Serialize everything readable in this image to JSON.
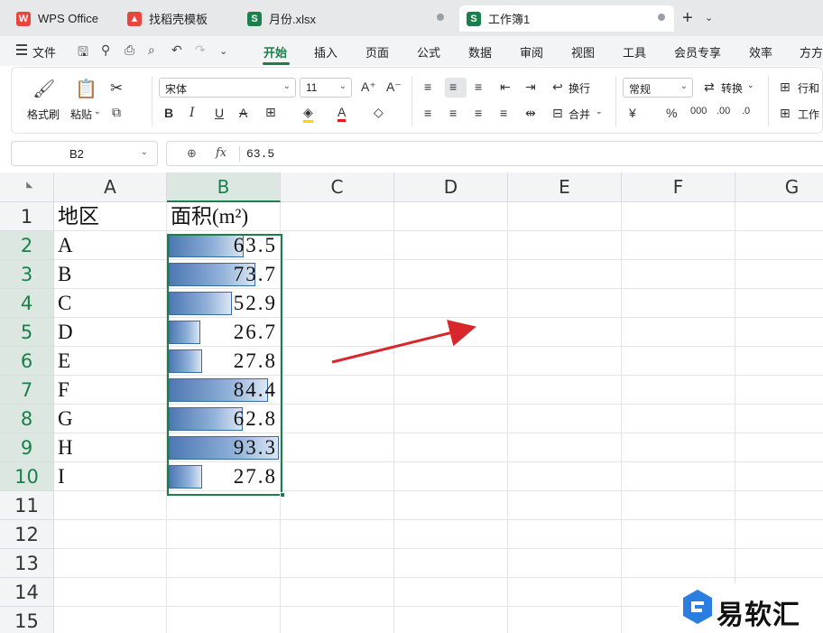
{
  "tabs": [
    {
      "label": "WPS Office",
      "icon": "wps-logo-icon",
      "color": "#e8453c"
    },
    {
      "label": "找稻壳模板",
      "icon": "docer-icon",
      "color": "#e8453c"
    },
    {
      "label": "月份.xlsx",
      "icon": "spreadsheet-icon",
      "color": "#1a7f4b"
    },
    {
      "label": "工作簿1",
      "icon": "spreadsheet-icon",
      "color": "#1a7f4b"
    }
  ],
  "menu": {
    "file": "文件",
    "items": [
      "开始",
      "插入",
      "页面",
      "公式",
      "数据",
      "审阅",
      "视图",
      "工具",
      "会员专享",
      "效率",
      "方方"
    ],
    "active": "开始"
  },
  "ribbon": {
    "format_painter": "格式刷",
    "paste": "粘贴",
    "font_name": "宋体",
    "font_size": "11",
    "wrap": "换行",
    "merge": "合并",
    "number_format": "常规",
    "convert": "转换",
    "row_col": "行和",
    "worksheet": "工作"
  },
  "formula_bar": {
    "name_box": "B2",
    "fx": "fx",
    "value": "63.5"
  },
  "grid": {
    "columns": [
      "A",
      "B",
      "C",
      "D",
      "E",
      "F",
      "G"
    ],
    "rows": [
      "1",
      "2",
      "3",
      "4",
      "5",
      "6",
      "7",
      "8",
      "9",
      "10",
      "11",
      "12",
      "13",
      "14",
      "15"
    ],
    "selected_column": "B",
    "header_a": "地区",
    "header_b": "面积(m²)",
    "data": [
      {
        "region": "A",
        "area": "63.5",
        "bar": 0.68
      },
      {
        "region": "B",
        "area": "73.7",
        "bar": 0.79
      },
      {
        "region": "C",
        "area": "52.9",
        "bar": 0.57
      },
      {
        "region": "D",
        "area": "26.7",
        "bar": 0.29
      },
      {
        "region": "E",
        "area": "27.8",
        "bar": 0.3
      },
      {
        "region": "F",
        "area": "84.4",
        "bar": 0.9
      },
      {
        "region": "G",
        "area": "62.8",
        "bar": 0.67
      },
      {
        "region": "H",
        "area": "93.3",
        "bar": 1.0
      },
      {
        "region": "I",
        "area": "27.8",
        "bar": 0.3
      }
    ]
  },
  "watermark": {
    "text": "易软汇"
  },
  "colors": {
    "accent": "#1a7f4b",
    "databar": "#4d78b3",
    "arrow": "#d9262b"
  }
}
